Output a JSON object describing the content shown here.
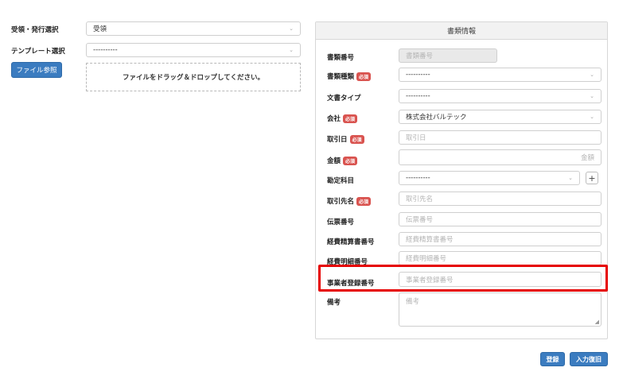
{
  "left": {
    "receive_label": "受領・発行選択",
    "receive_value": "受領",
    "template_label": "テンプレート選択",
    "template_value": "----------",
    "file_button": "ファイル参照",
    "dropzone_text": "ファイルをドラッグ＆ドロップしてください。"
  },
  "panel": {
    "title": "書類情報",
    "required_badge": "必須",
    "fields": {
      "doc_number": {
        "label": "書類番号",
        "placeholder": "書類番号"
      },
      "doc_kind": {
        "label": "書類種類",
        "value": "----------"
      },
      "doc_type": {
        "label": "文書タイプ",
        "value": "----------"
      },
      "company": {
        "label": "会社",
        "value": "株式会社バルテック"
      },
      "trade_date": {
        "label": "取引日",
        "placeholder": "取引日"
      },
      "amount": {
        "label": "金額",
        "placeholder": "金額"
      },
      "account": {
        "label": "勘定科目",
        "value": "----------"
      },
      "partner": {
        "label": "取引先名",
        "placeholder": "取引先名"
      },
      "slip_number": {
        "label": "伝票番号",
        "placeholder": "伝票番号"
      },
      "expense_number": {
        "label": "経費精算書番号",
        "placeholder": "経費精算書番号"
      },
      "expense_detail": {
        "label": "経費明細番号",
        "placeholder": "経費明細番号"
      },
      "registration": {
        "label": "事業者登録番号",
        "placeholder": "事業者登録番号"
      },
      "remarks": {
        "label": "備考",
        "placeholder": "備考"
      }
    }
  },
  "footer": {
    "register_button": "登録",
    "clear_button": "入力復旧"
  },
  "colors": {
    "accent": "#3b7cc0",
    "required": "#d9534f",
    "highlight": "#e60000"
  },
  "icons": {
    "caret": "chevron-down-icon",
    "plus": "plus-icon"
  }
}
